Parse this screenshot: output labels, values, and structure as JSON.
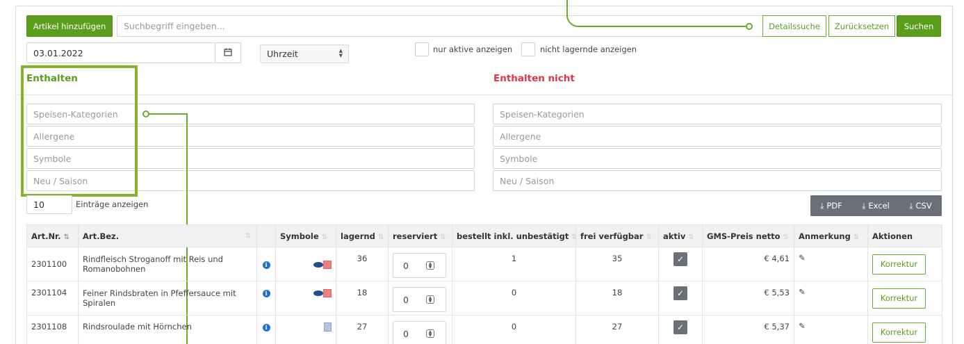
{
  "toolbar": {
    "add_label": "Artikel hinzufügen",
    "search_placeholder": "Suchbegriff eingeben...",
    "detail_search_label": "Detailssuche",
    "reset_label": "Zurücksetzen",
    "search_label": "Suchen"
  },
  "filters": {
    "date": "03.01.2022",
    "time_select": "Uhrzeit",
    "only_active_label": "nur aktive anzeigen",
    "not_stocked_label": "nicht lagernde anzeigen"
  },
  "include": {
    "title": "Enthalten",
    "fields": [
      "Speisen-Kategorien",
      "Allergene",
      "Symbole",
      "Neu / Saison"
    ]
  },
  "exclude": {
    "title": "Enthalten nicht",
    "fields": [
      "Speisen-Kategorien",
      "Allergene",
      "Symbole",
      "Neu / Saison"
    ]
  },
  "entries": {
    "count": "10",
    "label": "Einträge anzeigen"
  },
  "export": {
    "pdf": "PDF",
    "excel": "Excel",
    "csv": "CSV"
  },
  "table": {
    "headers": [
      "Art.Nr.",
      "Art.Bez.",
      "",
      "Symbole",
      "lagernd",
      "reserviert",
      "bestellt inkl. unbestätigt",
      "frei verfügbar",
      "aktiv",
      "GMS-Preis netto",
      "Anmerkung",
      "Aktionen"
    ],
    "rows": [
      {
        "nr": "2301100",
        "bez": "Rindfleisch Stroganoff mit Reis und Romanobohnen",
        "lagernd": "36",
        "reserviert": "0",
        "bestellt": "1",
        "frei": "35",
        "preis": "€ 4,61",
        "action": "Korrektur"
      },
      {
        "nr": "2301104",
        "bez": "Feiner Rindsbraten in Pfeffersauce mit Spiralen",
        "lagernd": "18",
        "reserviert": "0",
        "bestellt": "0",
        "frei": "18",
        "preis": "€ 5,53",
        "action": "Korrektur"
      },
      {
        "nr": "2301108",
        "bez": "Rindsroulade mit Hörnchen",
        "lagernd": "27",
        "reserviert": "0",
        "bestellt": "0",
        "frei": "27",
        "preis": "€ 5,37",
        "action": "Korrektur"
      }
    ]
  },
  "colors": {
    "brand_green": "#5a9e1b",
    "exclude_red": "#e2334a",
    "export_grey": "#6b7078"
  }
}
